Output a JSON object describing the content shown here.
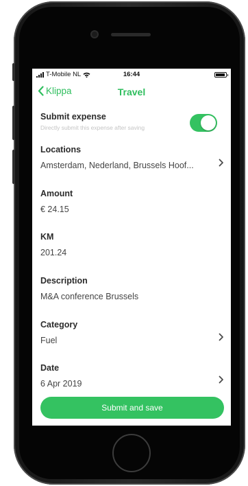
{
  "status_bar": {
    "carrier": "T-Mobile NL",
    "time": "16:44",
    "wifi_icon": "wifi-icon",
    "battery_icon": "battery-icon"
  },
  "nav": {
    "back_label": "Klippa",
    "title": "Travel",
    "back_icon": "chevron-left-icon"
  },
  "submit_expense": {
    "label": "Submit expense",
    "subtitle": "Directly submit this expense after saving",
    "enabled": true
  },
  "fields": {
    "locations": {
      "label": "Locations",
      "value": "Amsterdam, Nederland, Brussels Hoof..."
    },
    "amount": {
      "label": "Amount",
      "value": "€ 24.15"
    },
    "km": {
      "label": "KM",
      "value": "201.24"
    },
    "description": {
      "label": "Description",
      "value": "M&A conference Brussels"
    },
    "category": {
      "label": "Category",
      "value": "Fuel"
    },
    "date": {
      "label": "Date",
      "value": "6 Apr 2019"
    }
  },
  "footer": {
    "submit_label": "Submit and save"
  },
  "colors": {
    "accent": "#34c261",
    "screen_bg": "#f3f3f3",
    "frame": "#1e1e1e"
  }
}
